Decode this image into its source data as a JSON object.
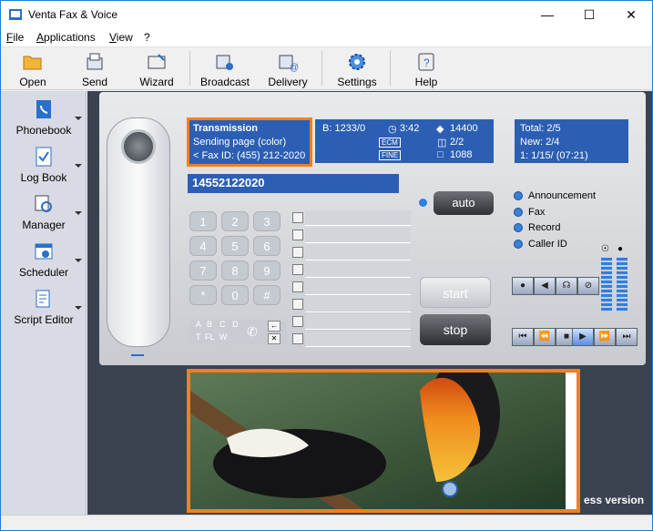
{
  "window": {
    "title": "Venta Fax & Voice"
  },
  "menu": [
    {
      "label": "File",
      "underline": "F"
    },
    {
      "label": "Applications",
      "underline": "A"
    },
    {
      "label": "View",
      "underline": "V"
    },
    {
      "label": "?"
    }
  ],
  "toolbar": {
    "open": "Open",
    "send": "Send",
    "wizard": "Wizard",
    "broadcast": "Broadcast",
    "delivery": "Delivery",
    "settings": "Settings",
    "help": "Help"
  },
  "sidebar": {
    "items": [
      {
        "label": "Phonebook",
        "icon": "phonebook-icon"
      },
      {
        "label": "Log Book",
        "icon": "logbook-icon"
      },
      {
        "label": "Manager",
        "icon": "manager-icon"
      },
      {
        "label": "Scheduler",
        "icon": "scheduler-icon"
      },
      {
        "label": "Script Editor",
        "icon": "script-editor-icon"
      }
    ]
  },
  "lcd": {
    "status_title": "Transmission",
    "status_line2": "Sending page (color)",
    "status_line3": "< Fax ID: (455) 212-2020",
    "b_count": "B: 1233/0",
    "duration": "3:42",
    "speed": "14400",
    "pages": "2/2",
    "size": "1088",
    "badge_ecm": "ECM",
    "badge_fine": "FINE",
    "total": "Total:  2/5",
    "new": "New:  2/4",
    "last": "1:  1/15/   (07:21)"
  },
  "dial_number": "14552122020",
  "keypad": [
    "1",
    "2",
    "3",
    "4",
    "5",
    "6",
    "7",
    "8",
    "9",
    "*",
    "0",
    "#"
  ],
  "alpha_keys": [
    "A",
    "B",
    "C",
    "D",
    "T",
    "FL",
    "W"
  ],
  "buttons": {
    "auto": "auto",
    "start": "start",
    "stop": "stop"
  },
  "modes": {
    "announcement": "Announcement",
    "fax": "Fax",
    "record": "Record",
    "caller_id": "Caller ID"
  },
  "overlay_text": "ess version",
  "colors": {
    "lcd": "#2c5fb3",
    "highlight": "#f08020"
  }
}
